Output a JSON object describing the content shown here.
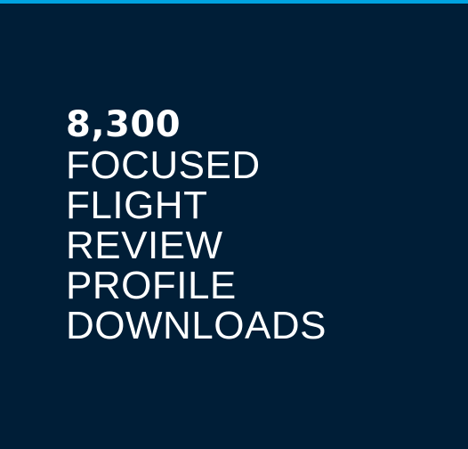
{
  "colors": {
    "background": "#001e37",
    "accent_bar": "#00a3e0",
    "text": "#ffffff"
  },
  "stat": {
    "value": "8,300",
    "label_lines": [
      "FOCUSED",
      "FLIGHT",
      "REVIEW",
      "PROFILE",
      "DOWNLOADS"
    ]
  }
}
